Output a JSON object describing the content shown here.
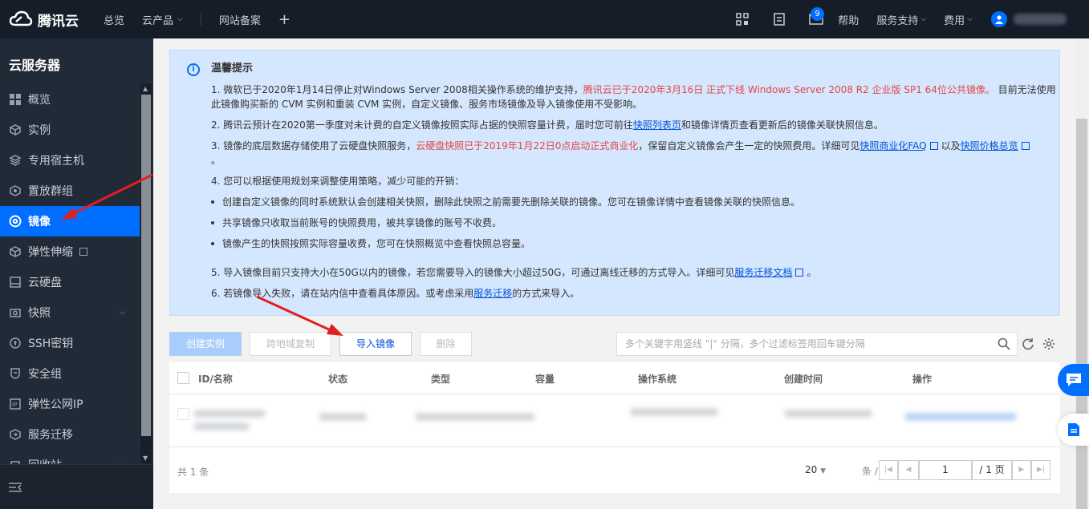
{
  "topbar": {
    "brand": "腾讯云",
    "nav": [
      "总览",
      "云产品",
      "网站备案"
    ],
    "message_count": "9",
    "help": "帮助",
    "support": "服务支持",
    "billing": "费用"
  },
  "sidebar": {
    "title": "云服务器",
    "items": [
      {
        "label": "概览",
        "icon": "grid-icon"
      },
      {
        "label": "实例",
        "icon": "cube-icon"
      },
      {
        "label": "专用宿主机",
        "icon": "layers-icon"
      },
      {
        "label": "置放群组",
        "icon": "hexagon-icon"
      },
      {
        "label": "镜像",
        "icon": "disc-icon",
        "active": true
      },
      {
        "label": "弹性伸缩",
        "icon": "scale-icon",
        "external": true
      },
      {
        "label": "云硬盘",
        "icon": "disk-icon"
      },
      {
        "label": "快照",
        "icon": "camera-icon",
        "expandable": true
      },
      {
        "label": "SSH密钥",
        "icon": "key-icon"
      },
      {
        "label": "安全组",
        "icon": "shield-icon"
      },
      {
        "label": "弹性公网IP",
        "icon": "ip-icon"
      },
      {
        "label": "服务迁移",
        "icon": "migrate-icon"
      },
      {
        "label": "回收站",
        "icon": "recycle-icon",
        "expandable": true
      }
    ]
  },
  "notice": {
    "title": "温馨提示",
    "p1a": "1. 微软已于2020年1月14日停止对Windows Server 2008相关操作系统的维护支持，",
    "p1red": "腾讯云已于2020年3月16日 正式下线 Windows Server 2008 R2 企业版 SP1 64位公共镜像。",
    "p1b": " 目前无法使用此镜像购买新的 CVM 实例和重装 CVM 实例，自定义镜像、服务市场镜像及导入镜像使用不受影响。",
    "p2a": "2. 腾讯云预计在2020第一季度对未计费的自定义镜像按照实际占据的快照容量计费，届时您可前往",
    "p2link": "快照列表页",
    "p2b": "和镜像详情页查看更新后的镜像关联快照信息。",
    "p3a": "3. 镜像的底层数据存储使用了云硬盘快照服务，",
    "p3red": "云硬盘快照已于2019年1月22日0点启动正式商业化",
    "p3b": "，保留自定义镜像会产生一定的快照费用。详细可见",
    "p3link1": "快照商业化FAQ",
    "p3mid": "以及",
    "p3link2": "快照价格总览",
    "p3end": "。",
    "p4": "4. 您可以根据使用规划来调整使用策略，减少可能的开销：",
    "b1": "创建自定义镜像的同时系统默认会创建相关快照，删除此快照之前需要先删除关联的镜像。您可在镜像详情中查看镜像关联的快照信息。",
    "b2": "共享镜像只收取当前账号的快照费用，被共享镜像的账号不收费。",
    "b3": "镜像产生的快照按照实际容量收费，您可在快照概览中查看快照总容量。",
    "p5a": "5. 导入镜像目前只支持大小在50G以内的镜像，若您需要导入的镜像大小超过50G，可通过离线迁移的方式导入。详细可见",
    "p5link": "服务迁移文档",
    "p5end": "。",
    "p6a": "6. 若镜像导入失败，请在站内信中查看具体原因。或考虑采用",
    "p6link": "服务迁移",
    "p6b": "的方式来导入。"
  },
  "toolbar": {
    "create": "创建实例",
    "copy": "跨地域复制",
    "import": "导入镜像",
    "delete": "删除",
    "search_placeholder": "多个关键字用竖线 \"|\" 分隔，多个过滤标签用回车键分隔"
  },
  "table": {
    "columns": [
      "ID/名称",
      "状态",
      "类型",
      "容量",
      "操作系统",
      "创建时间",
      "操作"
    ]
  },
  "pager": {
    "total": "共 1 条",
    "page_size": "20",
    "per_page": "条 / 页",
    "current": "1",
    "pages": "/ 1 页"
  },
  "colors": {
    "accent": "#006eff",
    "sidebar": "#212a37",
    "topbar": "#151d29",
    "notice_bg": "#d5e7fe",
    "red_text": "#e54545",
    "arrow": "#e02020"
  }
}
